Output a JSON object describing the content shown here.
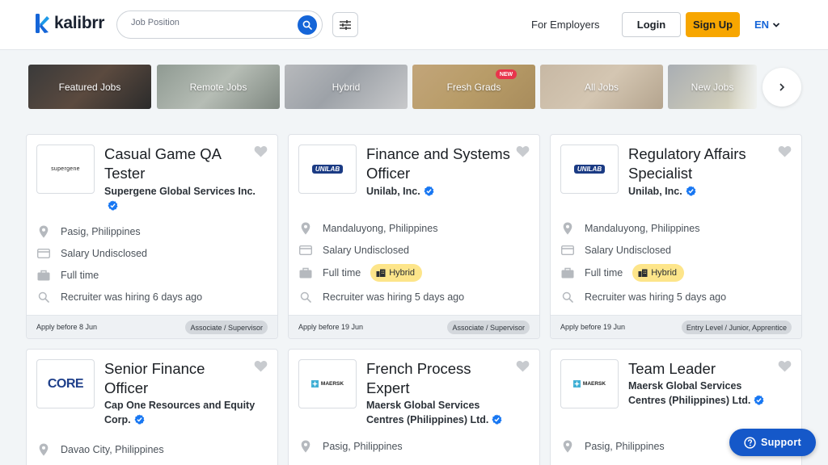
{
  "header": {
    "logo_text": "kalibrr",
    "search_placeholder": "Job Position",
    "for_employers": "For Employers",
    "login": "Login",
    "signup": "Sign Up",
    "language": "EN"
  },
  "categories": [
    {
      "label": "Featured Jobs"
    },
    {
      "label": "Remote Jobs"
    },
    {
      "label": "Hybrid"
    },
    {
      "label": "Fresh Grads",
      "badge": "NEW"
    },
    {
      "label": "All Jobs"
    },
    {
      "label": "New Jobs"
    }
  ],
  "jobs": [
    {
      "title": "Casual Game QA Tester",
      "company": "Supergene Global Services Inc.",
      "logo_text": "supergene",
      "location": "Pasig, Philippines",
      "salary": "Salary Undisclosed",
      "type": "Full time",
      "recruiter": "Recruiter was hiring 6 days ago",
      "apply": "Apply before 8 Jun",
      "level": "Associate / Supervisor"
    },
    {
      "title": "Finance and Systems Officer",
      "company": "Unilab, Inc.",
      "logo_text": "UNILAB",
      "location": "Mandaluyong, Philippines",
      "salary": "Salary Undisclosed",
      "type": "Full time",
      "badge": "Hybrid",
      "recruiter": "Recruiter was hiring 5 days ago",
      "apply": "Apply before 19 Jun",
      "level": "Associate / Supervisor"
    },
    {
      "title": "Regulatory Affairs Specialist",
      "company": "Unilab, Inc.",
      "logo_text": "UNILAB",
      "location": "Mandaluyong, Philippines",
      "salary": "Salary Undisclosed",
      "type": "Full time",
      "badge": "Hybrid",
      "recruiter": "Recruiter was hiring 5 days ago",
      "apply": "Apply before 19 Jun",
      "level": "Entry Level / Junior, Apprentice"
    },
    {
      "title": "Senior Finance Officer",
      "company": "Cap One Resources and Equity Corp.",
      "logo_text": "CORE",
      "location": "Davao City, Philippines"
    },
    {
      "title": "French Process Expert",
      "company": "Maersk Global Services Centres (Philippines) Ltd.",
      "logo_text": "MAERSK",
      "location": "Pasig, Philippines"
    },
    {
      "title": "Team Leader",
      "company": "Maersk Global Services Centres (Philippines) Ltd.",
      "logo_text": "MAERSK",
      "location": "Pasig, Philippines"
    }
  ],
  "support": "Support"
}
